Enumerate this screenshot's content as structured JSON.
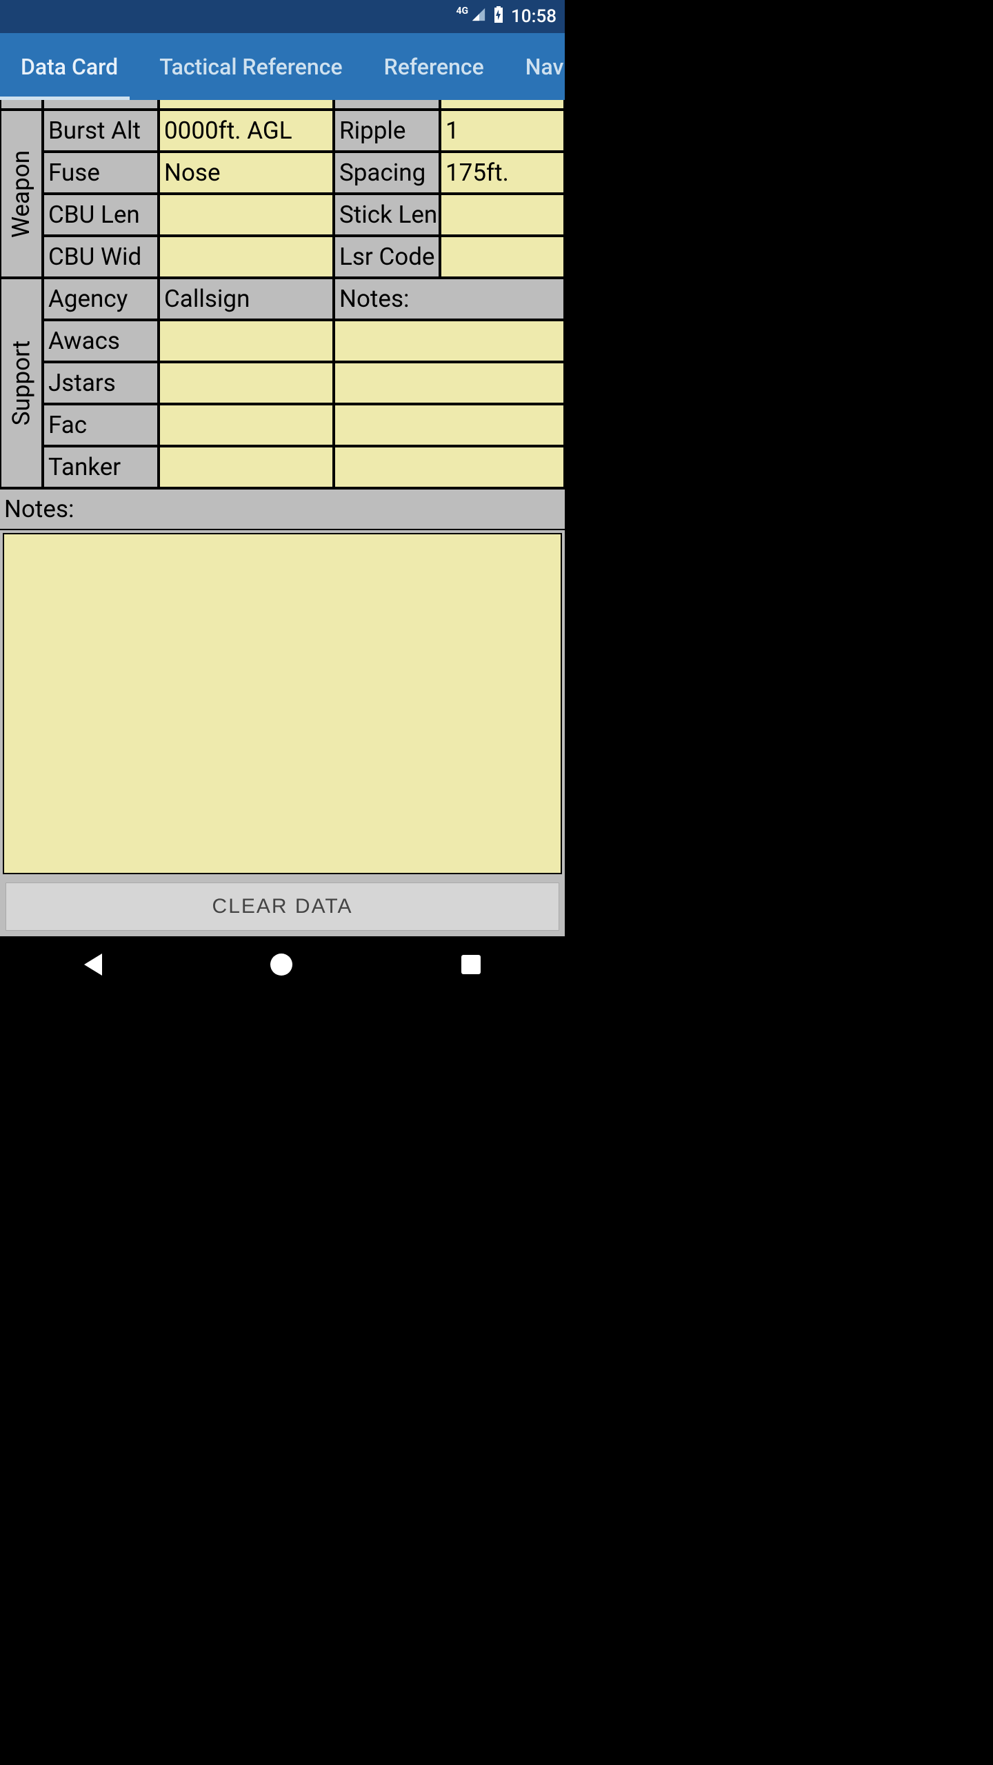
{
  "status": {
    "network": "4G",
    "time": "10:58"
  },
  "tabs": {
    "items": [
      "Data Card",
      "Tactical Reference",
      "Reference",
      "Navigatio"
    ],
    "active_index": 0
  },
  "weapon": {
    "section_label": "Weapon",
    "rows": [
      {
        "l1": "Burst Alt",
        "v1": "0000ft. AGL",
        "l2": "Ripple",
        "v2": "1"
      },
      {
        "l1": "Fuse",
        "v1": "Nose",
        "l2": "Spacing",
        "v2": "175ft."
      },
      {
        "l1": "CBU Len",
        "v1": "",
        "l2": "Stick Len",
        "v2": ""
      },
      {
        "l1": "CBU Wid",
        "v1": "",
        "l2": "Lsr Code",
        "v2": ""
      }
    ]
  },
  "support": {
    "section_label": "Support",
    "header": {
      "c1": "Agency",
      "c2": "Callsign",
      "c3": "Notes:"
    },
    "rows": [
      {
        "agency": "Awacs",
        "callsign": "",
        "notes": ""
      },
      {
        "agency": "Jstars",
        "callsign": "",
        "notes": ""
      },
      {
        "agency": "Fac",
        "callsign": "",
        "notes": ""
      },
      {
        "agency": "Tanker",
        "callsign": "",
        "notes": ""
      }
    ]
  },
  "notes": {
    "label": "Notes:",
    "value": ""
  },
  "buttons": {
    "clear": "CLEAR DATA"
  }
}
